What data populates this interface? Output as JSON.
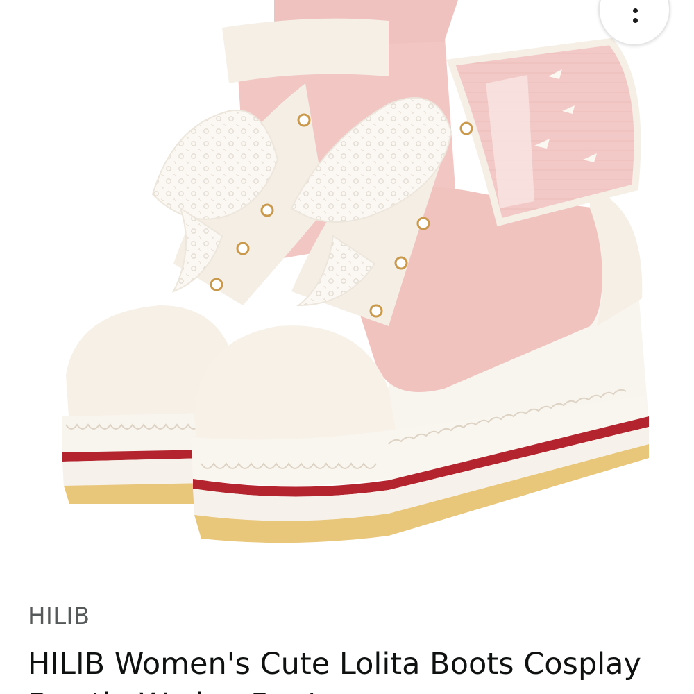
{
  "product": {
    "brand": "HILIB",
    "title": "HILIB Women's Cute Lolita Boots Cosplay Bowtie Wedge Boots",
    "image_alt": "Pink and white lace-up platform wedge boots"
  },
  "menu": {
    "icon": "more-vertical-icon"
  },
  "colors": {
    "brand_text": "#565959",
    "title_text": "#0f1111",
    "boot_pink": "#f1c6c3",
    "boot_white": "#f7f2ea",
    "sole_stripe": "#b3242e",
    "sole_gum": "#e8c67a"
  }
}
